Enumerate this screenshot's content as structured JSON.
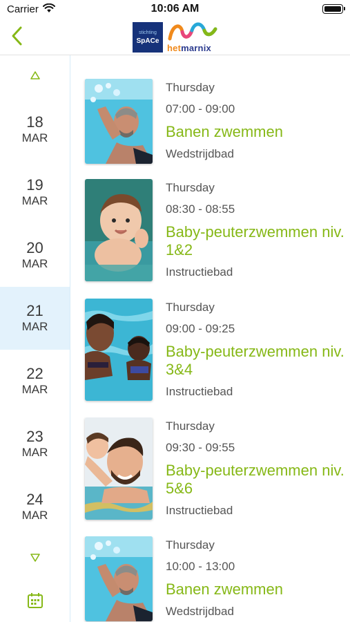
{
  "status_bar": {
    "carrier": "Carrier",
    "time": "10:06 AM"
  },
  "nav": {
    "back_icon": "chevron-left-icon",
    "logo_space_small": "stichting",
    "logo_space_name": "SpACe",
    "logo_het": "het",
    "logo_marnix": "marnix"
  },
  "colors": {
    "accent_green": "#86b817",
    "selected_date_bg": "#e3f2fc",
    "sidebar_border": "#d6ecf8"
  },
  "dates": [
    {
      "day": "18",
      "month": "MAR",
      "selected": false
    },
    {
      "day": "19",
      "month": "MAR",
      "selected": false
    },
    {
      "day": "20",
      "month": "MAR",
      "selected": false
    },
    {
      "day": "21",
      "month": "MAR",
      "selected": true
    },
    {
      "day": "22",
      "month": "MAR",
      "selected": false
    },
    {
      "day": "23",
      "month": "MAR",
      "selected": false
    },
    {
      "day": "24",
      "month": "MAR",
      "selected": false
    }
  ],
  "events": [
    {
      "weekday": "Thursday",
      "time": "07:00  -  09:00",
      "title": "Banen zwemmen",
      "location": "Wedstrijdbad",
      "image": "adult-swimmer-underwater"
    },
    {
      "weekday": "Thursday",
      "time": "08:30  -  08:55",
      "title": "Baby-peuterzwemmen niv. 1&2",
      "location": "Instructiebad",
      "image": "baby-in-pool"
    },
    {
      "weekday": "Thursday",
      "time": "09:00  -  09:25",
      "title": "Baby-peuterzwemmen niv. 3&4",
      "location": "Instructiebad",
      "image": "mother-and-child-in-pool"
    },
    {
      "weekday": "Thursday",
      "time": "09:30  -  09:55",
      "title": "Baby-peuterzwemmen niv. 5&6",
      "location": "Instructiebad",
      "image": "father-and-child-in-pool"
    },
    {
      "weekday": "Thursday",
      "time": "10:00  -  13:00",
      "title": "Banen zwemmen",
      "location": "Wedstrijdbad",
      "image": "adult-swimmer-underwater"
    }
  ]
}
